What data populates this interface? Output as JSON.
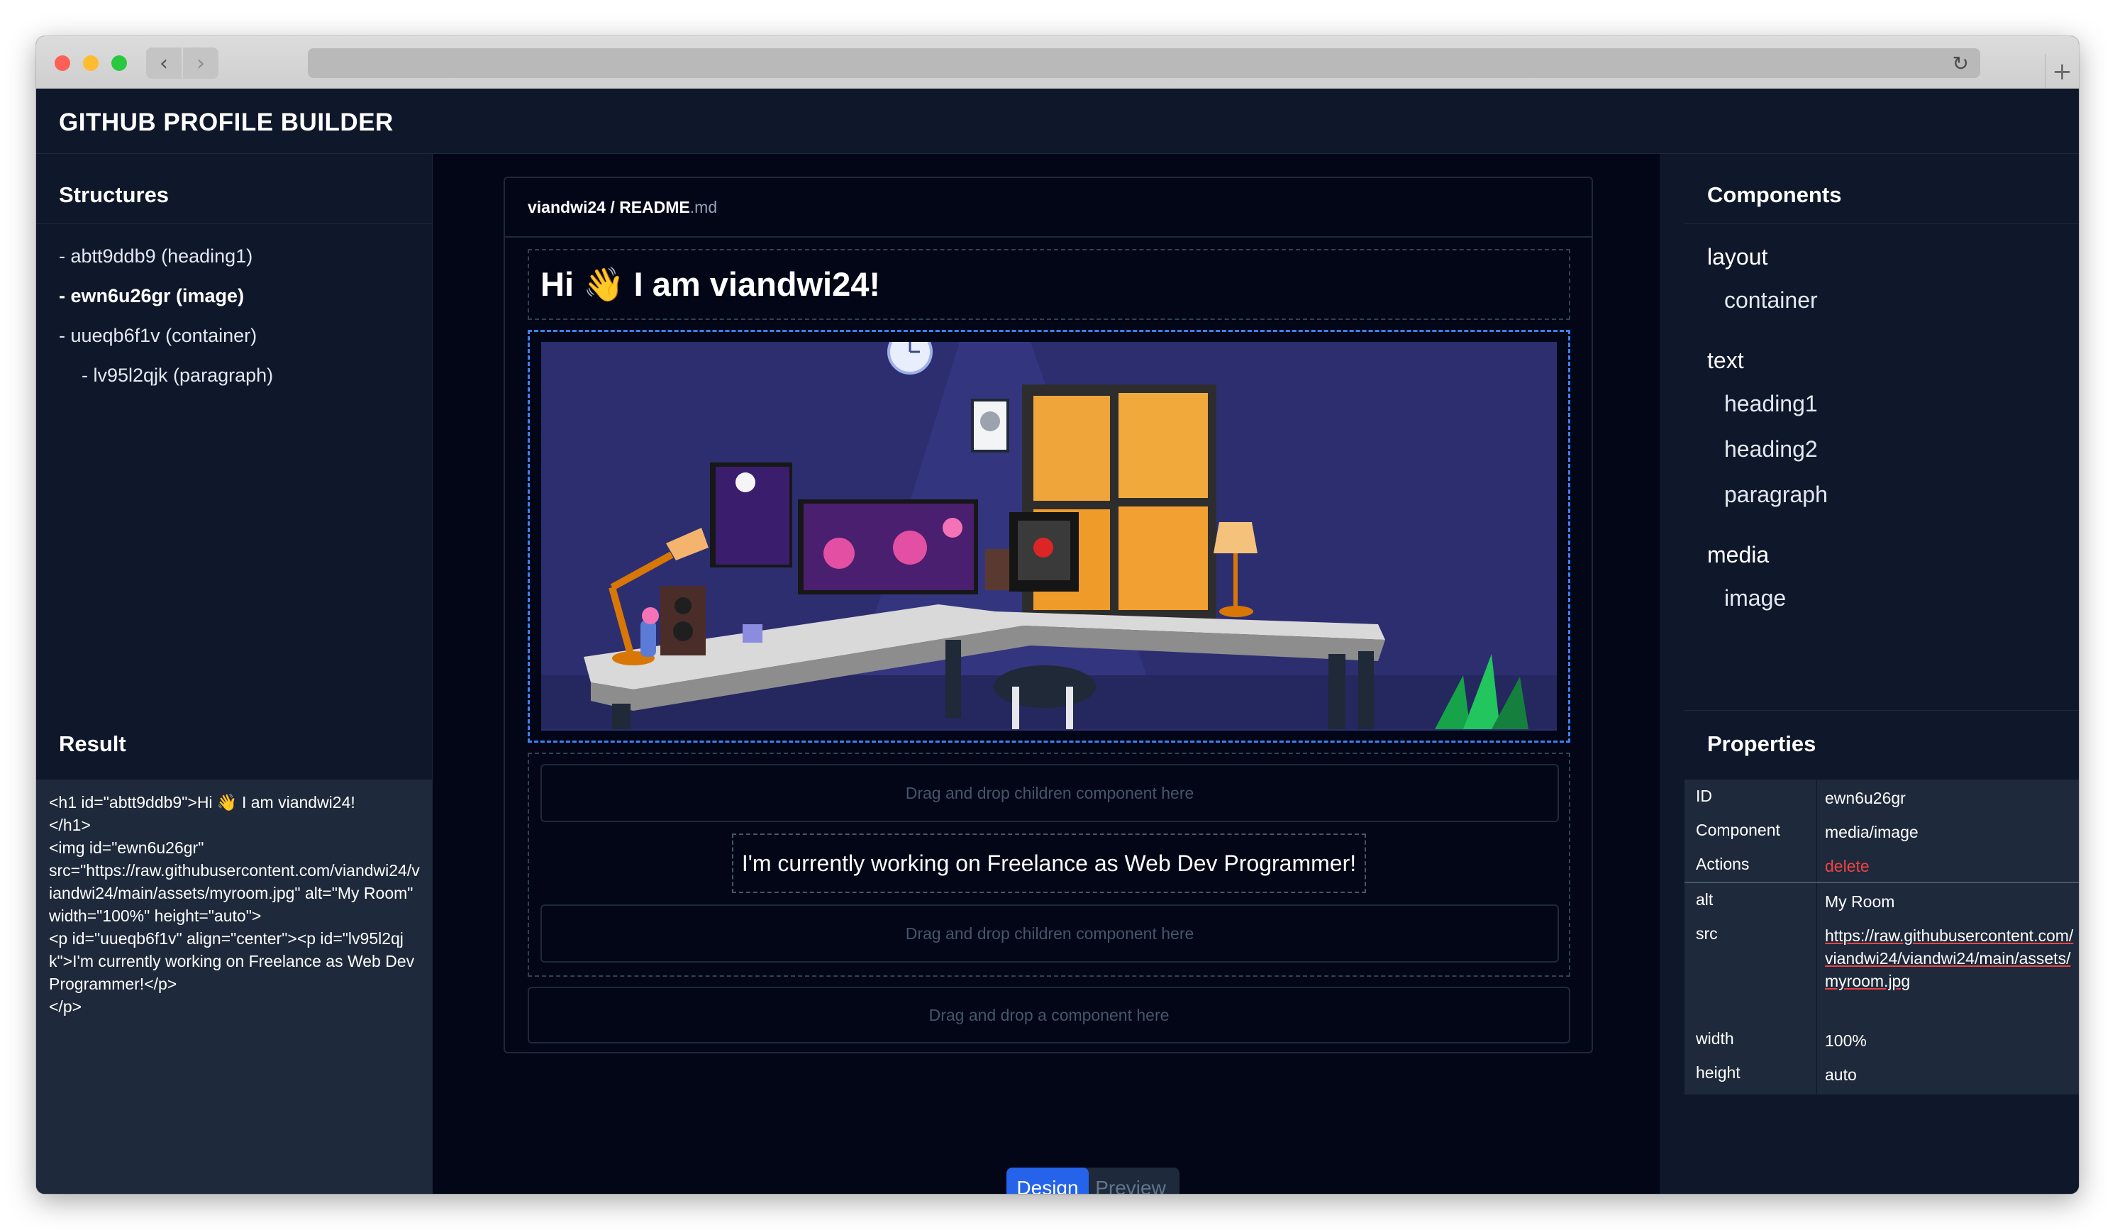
{
  "app": {
    "title": "GITHUB PROFILE BUILDER"
  },
  "structures": {
    "title": "Structures",
    "items": [
      {
        "label": "- abtt9ddb9 (heading1)"
      },
      {
        "label": "- ewn6u26gr (image)"
      },
      {
        "label": "- uueqb6f1v (container)"
      },
      {
        "label": "- lv95l2qjk (paragraph)"
      }
    ]
  },
  "result": {
    "title": "Result",
    "code": "<h1 id=\"abtt9ddb9\">Hi 👋 I am viandwi24!\n</h1>\n<img id=\"ewn6u26gr\"\nsrc=\"https://raw.githubusercontent.com/viandwi24/viandwi24/main/assets/myroom.jpg\" alt=\"My Room\" width=\"100%\" height=\"auto\">\n<p id=\"uueqb6f1v\" align=\"center\"><p id=\"lv95l2qjk\">I'm currently working on Freelance as Web Dev Programmer!</p>\n</p>"
  },
  "editor": {
    "repo": "viandwi24 / README",
    "ext": ".md",
    "heading": "Hi 👋 I am viandwi24!",
    "image_alt": "My Room",
    "drop_children_top": "Drag and drop children component here",
    "paragraph": "I'm currently working on Freelance as Web Dev Programmer!",
    "drop_children_bottom": "Drag and drop children component here",
    "drop_root": "Drag and drop a component here"
  },
  "mode_toggle": {
    "design": "Design",
    "preview": "Preview",
    "active": "Design"
  },
  "components": {
    "title": "Components",
    "groups": [
      {
        "name": "layout",
        "items": [
          "container"
        ]
      },
      {
        "name": "text",
        "items": [
          "heading1",
          "heading2",
          "paragraph"
        ]
      },
      {
        "name": "media",
        "items": [
          "image"
        ]
      }
    ]
  },
  "properties": {
    "title": "Properties",
    "id_label": "ID",
    "id_value": "ewn6u26gr",
    "component_label": "Component",
    "component_value": "media/image",
    "actions_label": "Actions",
    "actions_value": "delete",
    "alt_label": "alt",
    "alt_value": "My Room",
    "src_label": "src",
    "src_value": "https://raw.githubusercontent.com/viandwi24/viandwi24/main/assets/myroom.jpg",
    "width_label": "width",
    "width_value": "100%",
    "height_label": "height",
    "height_value": "auto"
  },
  "colors": {
    "accent": "#2563eb",
    "selection_border": "#3b82f6",
    "danger": "#ef4444",
    "panel": "#0f172a",
    "canvas": "#020617"
  }
}
